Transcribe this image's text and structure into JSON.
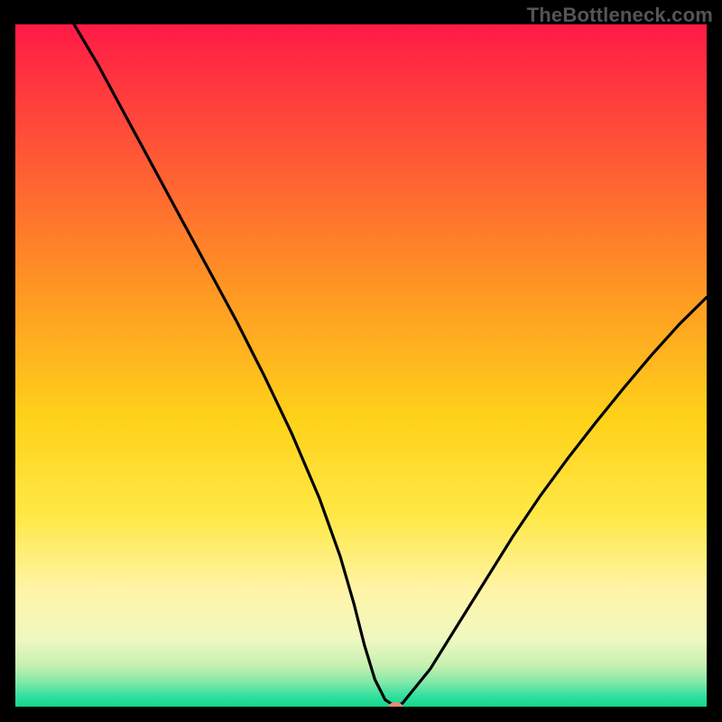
{
  "watermark": "TheBottleneck.com",
  "chart_data": {
    "type": "line",
    "title": "",
    "xlabel": "",
    "ylabel": "",
    "xlim": [
      0,
      100
    ],
    "ylim": [
      0,
      100
    ],
    "grid": false,
    "legend": false,
    "background_gradient_stops": [
      {
        "offset": 0.0,
        "color": "#ff1a46"
      },
      {
        "offset": 0.2,
        "color": "#ff5a35"
      },
      {
        "offset": 0.4,
        "color": "#ff9a22"
      },
      {
        "offset": 0.58,
        "color": "#ffd21a"
      },
      {
        "offset": 0.72,
        "color": "#ffe846"
      },
      {
        "offset": 0.83,
        "color": "#fff4a8"
      },
      {
        "offset": 0.9,
        "color": "#f0f8c0"
      },
      {
        "offset": 0.94,
        "color": "#c6f0b0"
      },
      {
        "offset": 0.965,
        "color": "#7fe8a8"
      },
      {
        "offset": 0.985,
        "color": "#30dfa0"
      },
      {
        "offset": 1.0,
        "color": "#14d68a"
      }
    ],
    "series": [
      {
        "name": "bottleneck-curve",
        "x": [
          8.5,
          12,
          16,
          20,
          24,
          28,
          32,
          36,
          40,
          44,
          47,
          49,
          50.5,
          52,
          53.5,
          55,
          56,
          60,
          64,
          68,
          72,
          76,
          80,
          84,
          88,
          92,
          96,
          100
        ],
        "y": [
          100,
          94,
          86.5,
          79,
          71.5,
          64,
          56.5,
          48.5,
          40,
          30.5,
          22,
          15,
          9,
          4,
          1,
          0,
          0.5,
          5.5,
          12,
          18.5,
          25,
          31,
          36.5,
          41.7,
          46.7,
          51.5,
          56,
          60
        ]
      }
    ],
    "marker": {
      "x": 55,
      "y": 0,
      "color": "#e58b7b",
      "rx": 8,
      "ry": 5
    }
  }
}
